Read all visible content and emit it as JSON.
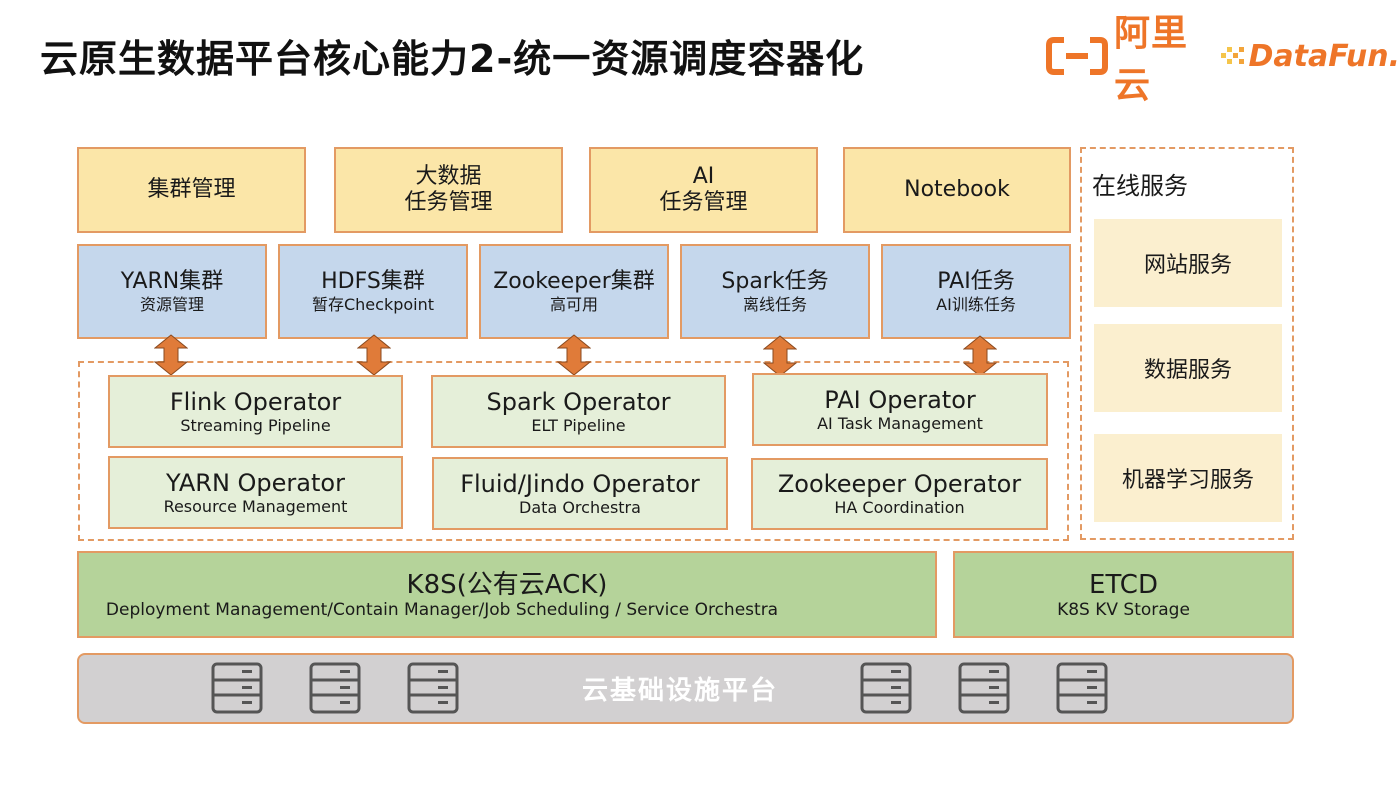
{
  "title": "云原生数据平台核心能力2-统一资源调度容器化",
  "logos": {
    "aliyun_text": "阿里云",
    "datafun_text": "DataFun."
  },
  "colors": {
    "yellow_box": "#fbe6a8",
    "blue_box": "#c5d7ec",
    "green_light_box": "#e5efd9",
    "green_box": "#b5d39a",
    "gray_box": "#d2d0d1",
    "border_orange": "#e39a63",
    "arrow_orange": "#e07b39",
    "brand_orange": "#ee7528"
  },
  "management_layer": [
    {
      "line1": "集群管理",
      "line2": ""
    },
    {
      "line1": "大数据",
      "line2": "任务管理"
    },
    {
      "line1": "AI",
      "line2": "任务管理"
    },
    {
      "line1": "Notebook",
      "line2": ""
    }
  ],
  "cluster_layer": [
    {
      "title": "YARN集群",
      "subtitle": "资源管理"
    },
    {
      "title": "HDFS集群",
      "subtitle": "暂存Checkpoint"
    },
    {
      "title": "Zookeeper集群",
      "subtitle": "高可用"
    },
    {
      "title": "Spark任务",
      "subtitle": "离线任务"
    },
    {
      "title": "PAI任务",
      "subtitle": "AI训练任务"
    }
  ],
  "operators": [
    {
      "title": "Flink Operator",
      "subtitle": "Streaming Pipeline"
    },
    {
      "title": "Spark Operator",
      "subtitle": "ELT Pipeline"
    },
    {
      "title": "PAI Operator",
      "subtitle": "AI Task Management"
    },
    {
      "title": "YARN Operator",
      "subtitle": "Resource Management"
    },
    {
      "title": "Fluid/Jindo Operator",
      "subtitle": "Data Orchestra"
    },
    {
      "title": "Zookeeper Operator",
      "subtitle": "HA Coordination"
    }
  ],
  "online_services": {
    "title": "在线服务",
    "items": [
      "网站服务",
      "数据服务",
      "机器学习服务"
    ]
  },
  "k8s": {
    "title": "K8S(公有云ACK)",
    "subtitle": "Deployment Management/Contain Manager/Job Scheduling / Service Orchestra"
  },
  "etcd": {
    "title": "ETCD",
    "subtitle": "K8S KV Storage"
  },
  "infrastructure": {
    "label": "云基础设施平台",
    "server_icon_count": 6
  }
}
